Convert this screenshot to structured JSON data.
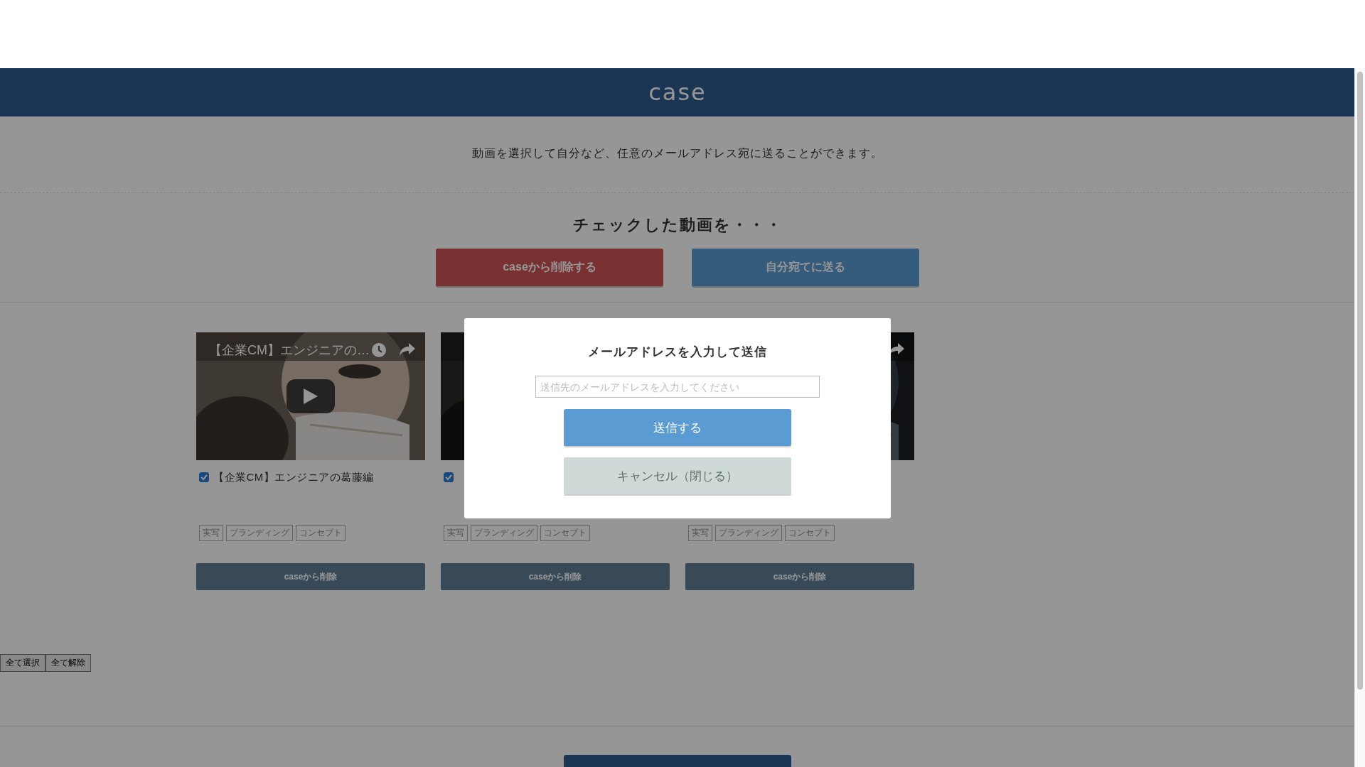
{
  "header": {
    "title": "case"
  },
  "intro": "動画を選択して自分など、任意のメールアドレス宛に送ることができます。",
  "bulk_actions": {
    "heading": "チェックした動画を・・・",
    "buttons": [
      {
        "label": "caseから削除する",
        "kind": "danger"
      },
      {
        "label": "自分宛てに送る",
        "kind": "primary"
      }
    ]
  },
  "videos": [
    {
      "player_title": "【企業CM】エンジニアの…",
      "title": "【企業CM】エンジニアの葛藤編",
      "checked": true,
      "tags": [
        "実写",
        "ブランディング",
        "コンセプト"
      ],
      "remove_button": "caseから削除"
    },
    {
      "checked": true,
      "tags": [
        "実写",
        "ブランディング",
        "コンセプト"
      ],
      "remove_button": "caseから削除"
    },
    {
      "tags": [
        "実写",
        "ブランディング",
        "コンセプト"
      ],
      "remove_button": "caseから削除"
    }
  ],
  "selection_buttons": [
    "全て選択",
    "全て解除"
  ],
  "modal": {
    "title": "メールアドレスを入力して送信",
    "email_field": {
      "placeholder": "送信先のメールアドレスを入力してください"
    },
    "buttons": [
      {
        "label": "送信する",
        "kind": "primary"
      },
      {
        "label": "キャンセル（閉じる）",
        "kind": "cancel"
      }
    ]
  }
}
